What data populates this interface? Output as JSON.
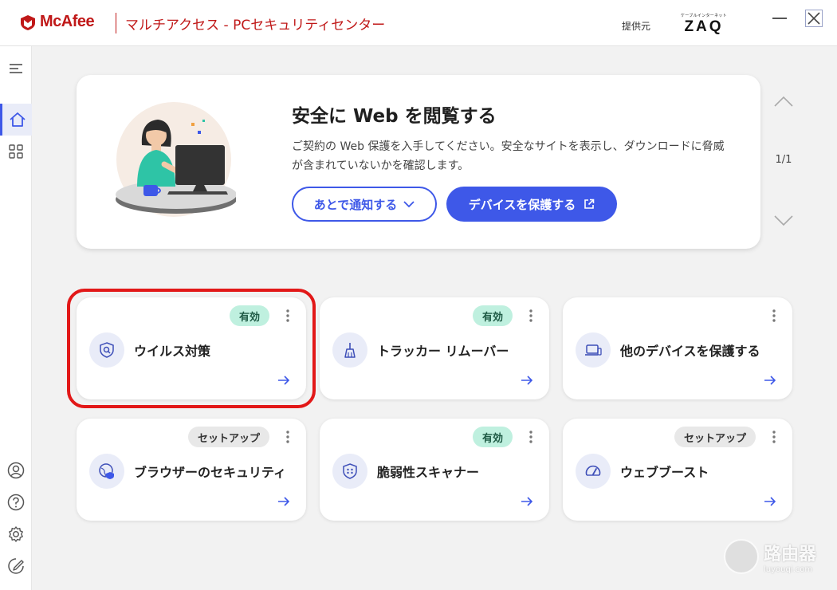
{
  "app": {
    "brand": "McAfee",
    "title": "マルチアクセス - PCセキュリティセンター",
    "provider_label": "提供元",
    "provider_logo_top": "ケーブルインターネット",
    "provider_logo_main": "ZAQ"
  },
  "colors": {
    "brand_red": "#c01818",
    "accent_blue": "#3e58e8",
    "badge_on_bg": "#bff0df",
    "badge_setup_bg": "#e8e8e8",
    "highlight_red": "#e21818"
  },
  "sidebar": {
    "items": [
      {
        "icon": "menu-icon"
      },
      {
        "icon": "home-icon",
        "active": true
      },
      {
        "icon": "apps-grid-icon"
      },
      {
        "icon": "account-icon"
      },
      {
        "icon": "help-icon"
      },
      {
        "icon": "settings-icon"
      },
      {
        "icon": "feedback-icon"
      }
    ]
  },
  "banner": {
    "title": "安全に Web を閲覧する",
    "description": "ご契約の Web 保護を入手してください。安全なサイトを表示し、ダウンロードに脅威が含まれていないかを確認します。",
    "later_button": "あとで通知する",
    "protect_button": "デバイスを保護する",
    "pager": "1/1"
  },
  "cards": [
    {
      "label": "ウイルス対策",
      "badge": "有効",
      "status": "on",
      "icon": "shield-scan-icon",
      "highlighted": true
    },
    {
      "label": "トラッカー リムーバー",
      "badge": "有効",
      "status": "on",
      "icon": "broom-icon"
    },
    {
      "label": "他のデバイスを保護する",
      "badge": "",
      "status": "none",
      "icon": "laptop-icon"
    },
    {
      "label": "ブラウザーのセキュリティ",
      "badge": "セットアップ",
      "status": "setup",
      "icon": "globe-shield-icon"
    },
    {
      "label": "脆弱性スキャナー",
      "badge": "有効",
      "status": "on",
      "icon": "bug-shield-icon"
    },
    {
      "label": "ウェブブースト",
      "badge": "セットアップ",
      "status": "setup",
      "icon": "speedometer-icon"
    }
  ],
  "watermark": {
    "text": "路由器",
    "subtext": "luyouqi.com"
  }
}
